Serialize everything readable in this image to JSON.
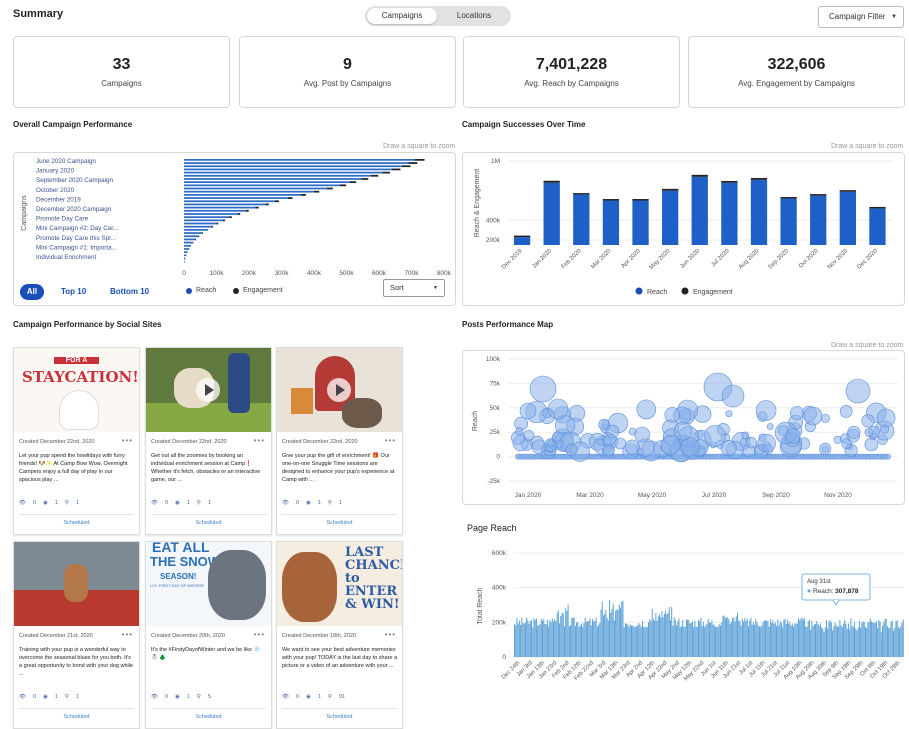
{
  "page_title": "Summary",
  "tabs": [
    {
      "label": "Campaigns",
      "active": true
    },
    {
      "label": "Locations",
      "active": false
    }
  ],
  "filter_label": "Campaign Filter",
  "kpis": [
    {
      "value": "33",
      "label": "Campaigns"
    },
    {
      "value": "9",
      "label": "Avg. Post by Campaigns"
    },
    {
      "value": "7,401,228",
      "label": "Avg. Reach by Campaigns"
    },
    {
      "value": "322,606",
      "label": "Avg. Engagement by Campaigns"
    }
  ],
  "sections": {
    "overall": "Overall Campaign Performance",
    "successes": "Campaign Successes Over Time",
    "social": "Campaign Performance by Social Sites",
    "map": "Posts Performance Map",
    "page_reach": "Page Reach"
  },
  "zoom_hint": "Draw a square to zoom",
  "bottom_controls": {
    "all": "All",
    "top10": "Top 10",
    "bottom10": "Bottom 10",
    "sort": "Sort",
    "legend_reach": "Reach",
    "legend_engagement": "Engagement"
  },
  "colors": {
    "primary": "#1a4fb8",
    "bar": "#2160c4",
    "dark": "#222222",
    "bubble": "#7aa7e8",
    "reach_line": "#5aa0d8"
  },
  "chart_data": [
    {
      "type": "bar",
      "orientation": "horizontal",
      "ylabel": "Campaigns",
      "categories": [
        "June 2020 Campaign",
        "January 2020",
        "September 2020 Campaign",
        "October 2020",
        "December 2019",
        "December 2020 Campaign",
        "Promote Day Care",
        "Mini Campaign #2: Day Car...",
        "Promote Day Care this Spr...",
        "Mini Campaign #1: Importa...",
        "Individual Enrichment"
      ],
      "xticks": [
        "0",
        "100k",
        "200k",
        "300k",
        "400k",
        "500k",
        "600k",
        "700k",
        "800k"
      ],
      "xlim": [
        0,
        800000
      ],
      "series": [
        {
          "name": "Reach",
          "values": [
            710000,
            690000,
            670000,
            640000,
            610000,
            575000,
            545000,
            510000,
            480000,
            440000,
            400000,
            360000,
            320000,
            280000,
            250000,
            220000,
            190000,
            165000,
            140000,
            120000,
            100000,
            85000,
            70000,
            55000,
            45000,
            35000,
            28000,
            20000,
            15000,
            10000,
            7000,
            4000,
            2000
          ]
        },
        {
          "name": "Engagement",
          "values": [
            30000,
            28000,
            27000,
            26000,
            24000,
            23000,
            22000,
            20000,
            19000,
            18000,
            16000,
            15000,
            14000,
            12000,
            11000,
            10000,
            9000,
            8000,
            7000,
            6000,
            5000,
            4000,
            3000,
            3000,
            2000,
            2000,
            1000,
            1000,
            1000,
            1000,
            500,
            300,
            200
          ]
        }
      ]
    },
    {
      "type": "bar",
      "stacked": true,
      "ylabel": "Reach & Engagement",
      "categories": [
        "Dec 2019",
        "Jan 2020",
        "Feb 2020",
        "Mar 2020",
        "Apr 2020",
        "May 2020",
        "Jun 2020",
        "Jul 2020",
        "Aug 2020",
        "Sep 2020",
        "Oct 2020",
        "Nov 2020",
        "Dec 2020"
      ],
      "yticks": [
        "1M",
        "400k",
        "200k"
      ],
      "series": [
        {
          "name": "Reach",
          "values": [
            230000,
            780000,
            660000,
            600000,
            600000,
            700000,
            840000,
            780000,
            810000,
            620000,
            650000,
            690000,
            520000
          ]
        },
        {
          "name": "Engagement",
          "values": [
            10000,
            20000,
            15000,
            12000,
            12000,
            18000,
            20000,
            18000,
            18000,
            14000,
            14000,
            15000,
            12000
          ]
        }
      ]
    },
    {
      "type": "scatter",
      "ylabel": "Reach",
      "xticks": [
        "Jan 2020",
        "Mar 2020",
        "May 2020",
        "Jul 2020",
        "Sep 2020",
        "Nov 2020"
      ],
      "yticks": [
        "100k",
        "75k",
        "50k",
        "25k",
        "0",
        "-25k"
      ],
      "ylim": [
        -25000,
        100000
      ]
    },
    {
      "type": "bar",
      "title": "Page Reach",
      "ylabel": "Total Reach",
      "yticks": [
        "600k",
        "400k",
        "200k",
        "0"
      ],
      "ylim": [
        0,
        600000
      ],
      "xticks": [
        "Dec 24th",
        "Jan 3rd",
        "Jan 13th",
        "Jan 23rd",
        "Feb 2nd",
        "Feb 12th",
        "Feb 22nd",
        "Mar 3rd",
        "Mar 13th",
        "Mar 23rd",
        "Apr 2nd",
        "Apr 12th",
        "Apr 22nd",
        "May 2nd",
        "May 12th",
        "May 22nd",
        "Jun 1st",
        "Jun 11th",
        "Jun 21st",
        "Jul 1st",
        "Jul 11th",
        "Jul 21st",
        "Jul 31st",
        "Aug 10th",
        "Aug 20th",
        "Aug 30th",
        "Sep 9th",
        "Sep 19th",
        "Sep 29th",
        "Oct 9th",
        "Oct 19th",
        "Oct 29th"
      ],
      "tooltip": {
        "date": "Aug 31st",
        "label": "Reach:",
        "value": "307,878"
      }
    }
  ],
  "posts": [
    {
      "date": "Created December 22nd, 2020",
      "text": "Let your pup spend the howlidays with furry friends! 🐶✨ At Camp Bow Wow, Overnight Campers enjoy a full day of play in our spacious play ...",
      "stats": [
        "0",
        "1",
        "1"
      ],
      "status": "Scheduled",
      "banner_top": "FOR A",
      "banner_main": "STAYCATION!"
    },
    {
      "date": "Created December 22nd, 2020",
      "text": "Get out all the zoomies by booking an individual enrichment session at Camp❗ Whether it's fetch, obstacles or an interactive game, our ...",
      "stats": [
        "0",
        "1",
        "1"
      ],
      "status": "Scheduled"
    },
    {
      "date": "Created December 22nd, 2020",
      "text": "Give your pup the gift of enrichment! 🎁 Our one-on-one Snuggle Time sessions are designed to enhance your pup's experience at Camp with ...",
      "stats": [
        "0",
        "1",
        "1"
      ],
      "status": "Scheduled"
    },
    {
      "date": "Created December 21st, 2020",
      "text": "Training with your pup is a wonderful way to overcome the seasonal blues for you both. It's a great opportunity to bond with your dog while ...",
      "stats": [
        "0",
        "1",
        "1"
      ],
      "status": "Scheduled"
    },
    {
      "date": "Created December 20th, 2020",
      "text": "It's the #FirstyDayofWinter and we be like ❄️ ☃️ 🌲",
      "stats": [
        "0",
        "1",
        "5"
      ],
      "status": "Scheduled",
      "banner_top": "EAT ALL",
      "banner_main": "THE SNOW",
      "banner_sub": "SEASON!",
      "banner_foot": "U.S. FIRST DAY OF WINTER!"
    },
    {
      "date": "Created December 18th, 2020",
      "text": "We want to see your best adventure memories with your pup! TODAY is the last day to share a picture or a video of an adventure with your ...",
      "stats": [
        "0",
        "1",
        "91"
      ],
      "status": "Scheduled",
      "banner_lines": [
        "LAST",
        "CHANCE",
        "to",
        "ENTER",
        "& WIN!"
      ]
    }
  ]
}
